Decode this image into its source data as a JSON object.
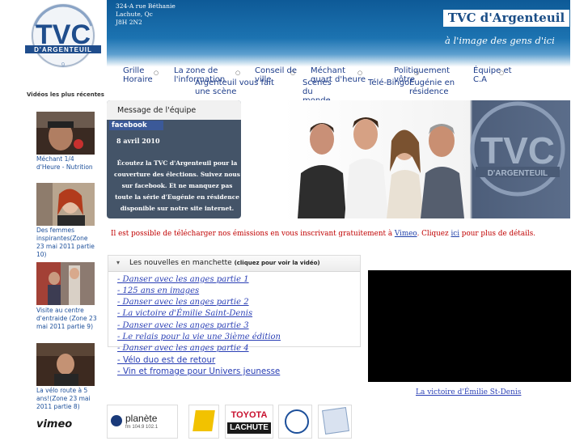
{
  "header": {
    "address_lines": [
      "324-A rue Béthanie",
      "Lachute, Qc",
      "J8H 2N2"
    ],
    "brand": "TVC d'Argenteuil",
    "tagline": "à l'image des gens d'ici"
  },
  "logo": {
    "letters": "TVC",
    "word": "D'ARGENTEUIL",
    "number": "9"
  },
  "nav": {
    "row1": [
      "Grille Horaire",
      "La zone de l'information",
      "Conseil de ville",
      "Méchant quart d'heure",
      "Politiquement vôtre",
      "Équipe et C.A"
    ],
    "row2": [
      "Argenteuil vous fait une scène",
      "Scènes du monde",
      "Télé-Bingo",
      "Eugénie en résidence"
    ]
  },
  "sidebar": {
    "title": "Vidéos les plus récentes",
    "videos": [
      {
        "caption": "Méchant 1/4 d'Heure - Nutrition"
      },
      {
        "caption": "Des femmes inspirantes(Zone 23 mai 2011 partie 10)"
      },
      {
        "caption": "Visite au centre d'entraide (Zone 23 mai 2011 partie 9)"
      },
      {
        "caption": "La vélo route à 5 ans!(Zone 23 mai 2011 partie 8)"
      }
    ],
    "vimeo_logo": "vimeo"
  },
  "message": {
    "header": "Message de l'équipe",
    "facebook_label": "facebook",
    "date": "8 avril 2010",
    "body": "Écoutez la TVC d'Argenteuil  pour la couverture des élections. Suivez nous sur facebook. Et ne manquez pas toute la série d'Eugénie en résidence disponible sur notre site internet."
  },
  "notice": {
    "part1": "Il est possible de télécharger nos émissions en vous inscrivant gratuitement à ",
    "link1": "Vimeo",
    "part2": ". Cliquez ",
    "link2": "ici",
    "part3": " pour plus de détails."
  },
  "news": {
    "title": "Les nouvelles en manchette",
    "hint": "(cliquez pour voir la vidéo)",
    "items": [
      "- Danser avec les anges partie 1",
      "- 125 ans en images",
      "- Danser avec les anges partie 2",
      "- La victoire d'Émilie Saint-Denis",
      "- Danser avec les anges partie 3",
      "- Le relais pour la vie une 3ième édition",
      "- Danser avec les anges partie 4",
      "- Vélo duo est de retour",
      "- Vin et fromage pour Univers jeunesse"
    ]
  },
  "video": {
    "caption": "La victoire d'Émilie St-Denis"
  },
  "sponsors": {
    "planete_name": "planète",
    "planete_freq": "fm 104.9 102.1",
    "toyota_brand": "TOYOTA",
    "toyota_city": "LACHUTE"
  },
  "colors": {
    "brand_blue": "#1a4d86",
    "link": "#2a3fb5",
    "notice_red": "#c00000",
    "header_blue": "#1c73b1"
  }
}
